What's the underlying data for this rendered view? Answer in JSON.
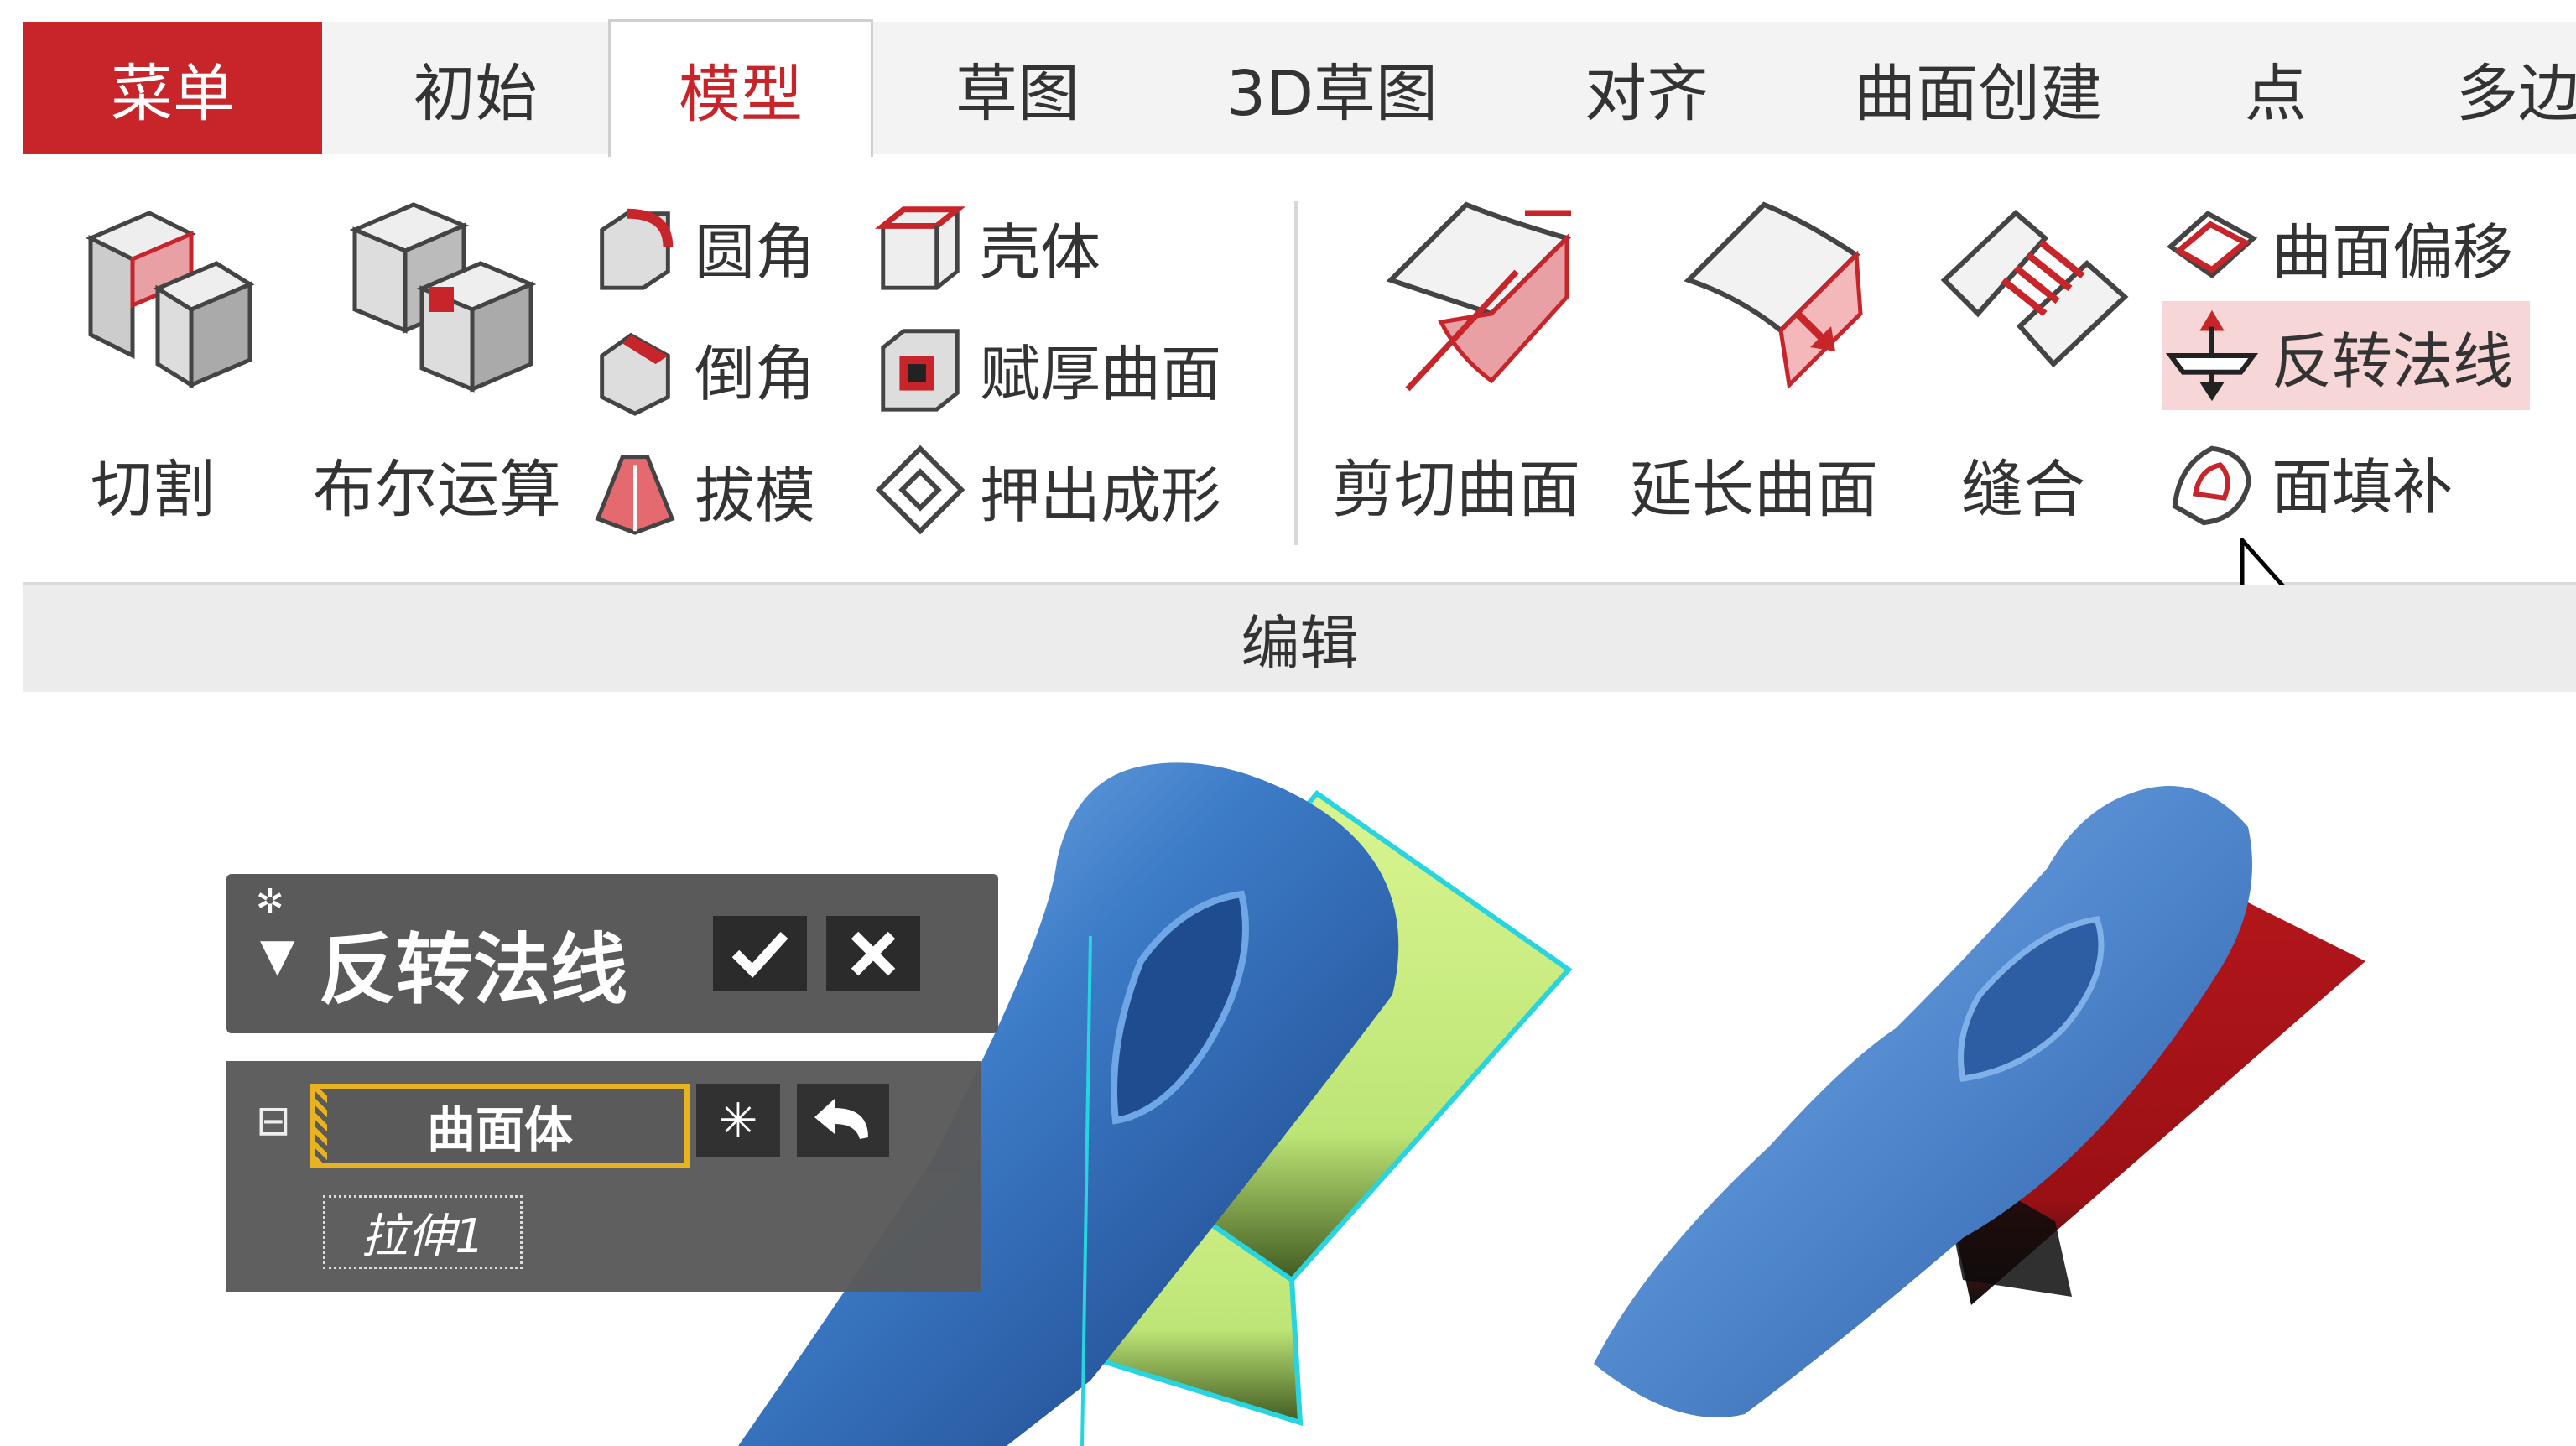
{
  "tabs": [
    {
      "label": "菜单",
      "kind": "menu"
    },
    {
      "label": "初始"
    },
    {
      "label": "模型",
      "active": true
    },
    {
      "label": "草图"
    },
    {
      "label": "3D草图"
    },
    {
      "label": "对齐"
    },
    {
      "label": "曲面创建"
    },
    {
      "label": "点"
    },
    {
      "label": "多边"
    }
  ],
  "ribbon": {
    "large_buttons": {
      "cut": "切割",
      "boolean": "布尔运算",
      "trim_surface": "剪切曲面",
      "extend_surface": "延长曲面",
      "stitch": "缝合"
    },
    "small_buttons": {
      "fillet": "圆角",
      "chamfer": "倒角",
      "draft": "拔模",
      "shell": "壳体",
      "thicken": "赋厚曲面",
      "emboss": "押出成形",
      "offset_surface": "曲面偏移",
      "reverse_normal": "反转法线",
      "fill_face": "面填补"
    },
    "group_label": "编辑"
  },
  "dialog": {
    "title": "反转法线",
    "field_value": "曲面体",
    "feature_item": "拉伸1",
    "collapse_symbol": "⊟"
  },
  "colors": {
    "menu_tab": "#c8252b",
    "accent": "#c8252b",
    "hover": "#f6d6d7",
    "dialog_bg": "#5a5a5a",
    "field_border": "#e8b320",
    "surface_before": "#d9f58f",
    "surface_after": "#b3161b",
    "body_blue": "#3f7dc4"
  }
}
